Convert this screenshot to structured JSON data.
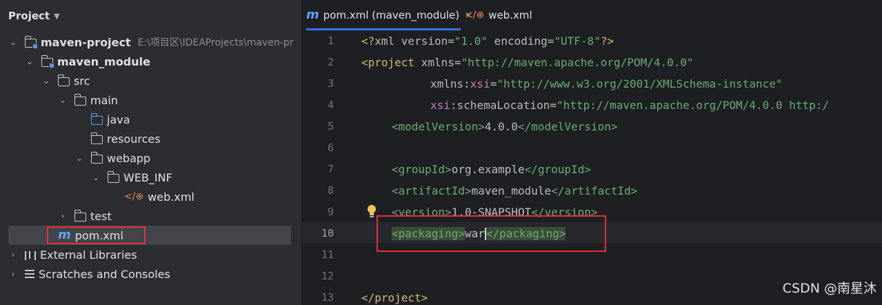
{
  "project_panel": {
    "title": "Project",
    "tree": [
      {
        "label": "maven-project",
        "path": "E:\\项目区\\IDEAProjects\\maven-pr",
        "bold": true
      },
      {
        "label": "maven_module",
        "bold": true
      },
      {
        "label": "src"
      },
      {
        "label": "main"
      },
      {
        "label": "java"
      },
      {
        "label": "resources"
      },
      {
        "label": "webapp"
      },
      {
        "label": "WEB_INF"
      },
      {
        "label": "web.xml"
      },
      {
        "label": "test"
      },
      {
        "label": "pom.xml"
      },
      {
        "label": "External Libraries"
      },
      {
        "label": "Scratches and Consoles"
      }
    ]
  },
  "editor": {
    "tabs": [
      {
        "label": "pom.xml (maven_module)",
        "close": "×",
        "active": true
      },
      {
        "label": "web.xml",
        "active": false
      }
    ],
    "line_numbers": [
      "1",
      "2",
      "3",
      "4",
      "5",
      "6",
      "7",
      "8",
      "9",
      "10",
      "11",
      "12",
      "13"
    ],
    "current_line": "10",
    "lines": {
      "l1": {
        "a": "<?",
        "b": "xml version",
        "c": "=",
        "d": "\"1.0\"",
        "e": " encoding",
        "f": "=",
        "g": "\"UTF-8\"",
        "h": "?>"
      },
      "l2": {
        "a": "<project",
        "b": " xmlns",
        "c": "=",
        "d": "\"http://maven.apache.org/POM/4.0.0\""
      },
      "l3": {
        "a": "xmlns:",
        "b": "xsi",
        "c": "=",
        "d": "\"http://www.w3.org/2001/XMLSchema-instance\""
      },
      "l4": {
        "a": "xsi",
        "b": ":schemaLocation",
        "c": "=",
        "d": "\"http://maven.apache.org/POM/4.0.0 http:/"
      },
      "l5": {
        "a": "<modelVersion>",
        "b": "4.0.0",
        "c": "</modelVersion>"
      },
      "l7": {
        "a": "<groupId>",
        "b": "org.example",
        "c": "</groupId>"
      },
      "l8": {
        "a": "<artifactId>",
        "b": "maven_module",
        "c": "</artifactId>"
      },
      "l9": {
        "a": "<version>",
        "b": "1.0-SNAPSHOT",
        "c": "</version>"
      },
      "l10": {
        "a": "<packaging>",
        "b": "war",
        "c": "</packaging>"
      },
      "l13": {
        "a": "</project>"
      }
    }
  },
  "watermark": "CSDN @南星沐",
  "colors": {
    "highlight_box": "#e0343a",
    "accent": "#3574f0"
  }
}
